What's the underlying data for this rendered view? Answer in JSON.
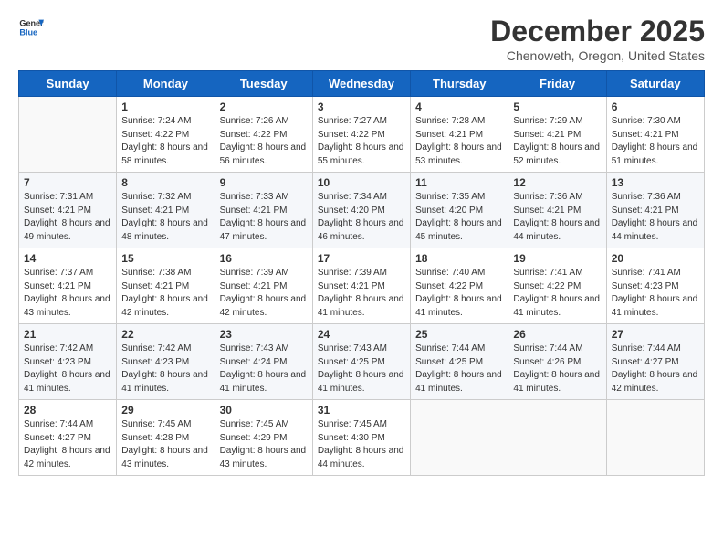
{
  "header": {
    "logo_line1": "General",
    "logo_line2": "Blue",
    "title": "December 2025",
    "subtitle": "Chenoweth, Oregon, United States"
  },
  "weekdays": [
    "Sunday",
    "Monday",
    "Tuesday",
    "Wednesday",
    "Thursday",
    "Friday",
    "Saturday"
  ],
  "weeks": [
    [
      {
        "day": "",
        "sunrise": "",
        "sunset": "",
        "daylight": ""
      },
      {
        "day": "1",
        "sunrise": "Sunrise: 7:24 AM",
        "sunset": "Sunset: 4:22 PM",
        "daylight": "Daylight: 8 hours and 58 minutes."
      },
      {
        "day": "2",
        "sunrise": "Sunrise: 7:26 AM",
        "sunset": "Sunset: 4:22 PM",
        "daylight": "Daylight: 8 hours and 56 minutes."
      },
      {
        "day": "3",
        "sunrise": "Sunrise: 7:27 AM",
        "sunset": "Sunset: 4:22 PM",
        "daylight": "Daylight: 8 hours and 55 minutes."
      },
      {
        "day": "4",
        "sunrise": "Sunrise: 7:28 AM",
        "sunset": "Sunset: 4:21 PM",
        "daylight": "Daylight: 8 hours and 53 minutes."
      },
      {
        "day": "5",
        "sunrise": "Sunrise: 7:29 AM",
        "sunset": "Sunset: 4:21 PM",
        "daylight": "Daylight: 8 hours and 52 minutes."
      },
      {
        "day": "6",
        "sunrise": "Sunrise: 7:30 AM",
        "sunset": "Sunset: 4:21 PM",
        "daylight": "Daylight: 8 hours and 51 minutes."
      }
    ],
    [
      {
        "day": "7",
        "sunrise": "Sunrise: 7:31 AM",
        "sunset": "Sunset: 4:21 PM",
        "daylight": "Daylight: 8 hours and 49 minutes."
      },
      {
        "day": "8",
        "sunrise": "Sunrise: 7:32 AM",
        "sunset": "Sunset: 4:21 PM",
        "daylight": "Daylight: 8 hours and 48 minutes."
      },
      {
        "day": "9",
        "sunrise": "Sunrise: 7:33 AM",
        "sunset": "Sunset: 4:21 PM",
        "daylight": "Daylight: 8 hours and 47 minutes."
      },
      {
        "day": "10",
        "sunrise": "Sunrise: 7:34 AM",
        "sunset": "Sunset: 4:20 PM",
        "daylight": "Daylight: 8 hours and 46 minutes."
      },
      {
        "day": "11",
        "sunrise": "Sunrise: 7:35 AM",
        "sunset": "Sunset: 4:20 PM",
        "daylight": "Daylight: 8 hours and 45 minutes."
      },
      {
        "day": "12",
        "sunrise": "Sunrise: 7:36 AM",
        "sunset": "Sunset: 4:21 PM",
        "daylight": "Daylight: 8 hours and 44 minutes."
      },
      {
        "day": "13",
        "sunrise": "Sunrise: 7:36 AM",
        "sunset": "Sunset: 4:21 PM",
        "daylight": "Daylight: 8 hours and 44 minutes."
      }
    ],
    [
      {
        "day": "14",
        "sunrise": "Sunrise: 7:37 AM",
        "sunset": "Sunset: 4:21 PM",
        "daylight": "Daylight: 8 hours and 43 minutes."
      },
      {
        "day": "15",
        "sunrise": "Sunrise: 7:38 AM",
        "sunset": "Sunset: 4:21 PM",
        "daylight": "Daylight: 8 hours and 42 minutes."
      },
      {
        "day": "16",
        "sunrise": "Sunrise: 7:39 AM",
        "sunset": "Sunset: 4:21 PM",
        "daylight": "Daylight: 8 hours and 42 minutes."
      },
      {
        "day": "17",
        "sunrise": "Sunrise: 7:39 AM",
        "sunset": "Sunset: 4:21 PM",
        "daylight": "Daylight: 8 hours and 41 minutes."
      },
      {
        "day": "18",
        "sunrise": "Sunrise: 7:40 AM",
        "sunset": "Sunset: 4:22 PM",
        "daylight": "Daylight: 8 hours and 41 minutes."
      },
      {
        "day": "19",
        "sunrise": "Sunrise: 7:41 AM",
        "sunset": "Sunset: 4:22 PM",
        "daylight": "Daylight: 8 hours and 41 minutes."
      },
      {
        "day": "20",
        "sunrise": "Sunrise: 7:41 AM",
        "sunset": "Sunset: 4:23 PM",
        "daylight": "Daylight: 8 hours and 41 minutes."
      }
    ],
    [
      {
        "day": "21",
        "sunrise": "Sunrise: 7:42 AM",
        "sunset": "Sunset: 4:23 PM",
        "daylight": "Daylight: 8 hours and 41 minutes."
      },
      {
        "day": "22",
        "sunrise": "Sunrise: 7:42 AM",
        "sunset": "Sunset: 4:23 PM",
        "daylight": "Daylight: 8 hours and 41 minutes."
      },
      {
        "day": "23",
        "sunrise": "Sunrise: 7:43 AM",
        "sunset": "Sunset: 4:24 PM",
        "daylight": "Daylight: 8 hours and 41 minutes."
      },
      {
        "day": "24",
        "sunrise": "Sunrise: 7:43 AM",
        "sunset": "Sunset: 4:25 PM",
        "daylight": "Daylight: 8 hours and 41 minutes."
      },
      {
        "day": "25",
        "sunrise": "Sunrise: 7:44 AM",
        "sunset": "Sunset: 4:25 PM",
        "daylight": "Daylight: 8 hours and 41 minutes."
      },
      {
        "day": "26",
        "sunrise": "Sunrise: 7:44 AM",
        "sunset": "Sunset: 4:26 PM",
        "daylight": "Daylight: 8 hours and 41 minutes."
      },
      {
        "day": "27",
        "sunrise": "Sunrise: 7:44 AM",
        "sunset": "Sunset: 4:27 PM",
        "daylight": "Daylight: 8 hours and 42 minutes."
      }
    ],
    [
      {
        "day": "28",
        "sunrise": "Sunrise: 7:44 AM",
        "sunset": "Sunset: 4:27 PM",
        "daylight": "Daylight: 8 hours and 42 minutes."
      },
      {
        "day": "29",
        "sunrise": "Sunrise: 7:45 AM",
        "sunset": "Sunset: 4:28 PM",
        "daylight": "Daylight: 8 hours and 43 minutes."
      },
      {
        "day": "30",
        "sunrise": "Sunrise: 7:45 AM",
        "sunset": "Sunset: 4:29 PM",
        "daylight": "Daylight: 8 hours and 43 minutes."
      },
      {
        "day": "31",
        "sunrise": "Sunrise: 7:45 AM",
        "sunset": "Sunset: 4:30 PM",
        "daylight": "Daylight: 8 hours and 44 minutes."
      },
      {
        "day": "",
        "sunrise": "",
        "sunset": "",
        "daylight": ""
      },
      {
        "day": "",
        "sunrise": "",
        "sunset": "",
        "daylight": ""
      },
      {
        "day": "",
        "sunrise": "",
        "sunset": "",
        "daylight": ""
      }
    ]
  ]
}
